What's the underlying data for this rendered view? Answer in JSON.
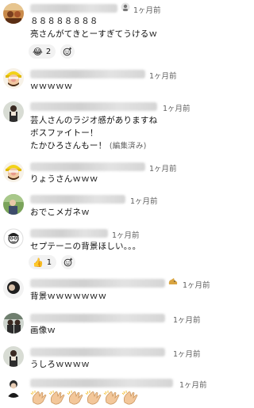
{
  "comments": [
    {
      "time": "1ヶ月前",
      "lines": [
        "８８８８８８８８",
        "亮さんがてきとーすぎてうけるｗ"
      ],
      "reaction": {
        "emoji": "😂",
        "count": "2"
      }
    },
    {
      "time": "1ヶ月前",
      "lines": [
        "ｗｗｗｗｗ"
      ]
    },
    {
      "time": "1ヶ月前",
      "lines": [
        "芸人さんのラジオ感がありますね",
        "ボスファイトー！",
        "たかひろさんもー！"
      ],
      "edited": "(編集済み)"
    },
    {
      "time": "1ヶ月前",
      "lines": [
        "りょうさんｗｗｗ"
      ]
    },
    {
      "time": "1ヶ月前",
      "lines": [
        "おでこメガネｗ"
      ]
    },
    {
      "time": "1ヶ月前",
      "lines": [
        "セプテーニの背景ほしい。。。"
      ],
      "reaction": {
        "emoji": "👍",
        "count": "1"
      }
    },
    {
      "time": "1ヶ月前",
      "lines": [
        "背景ｗｗｗｗｗｗｗ"
      ]
    },
    {
      "time": "1ヶ月前",
      "lines": [
        "画像ｗ"
      ]
    },
    {
      "time": "1ヶ月前",
      "lines": [
        "うしろｗｗｗｗ"
      ]
    },
    {
      "time": "1ヶ月前",
      "lines": [],
      "claps": 6
    }
  ],
  "icons": {
    "add_reaction": "add-reaction-icon",
    "clap": "clapping-hands-icon"
  }
}
